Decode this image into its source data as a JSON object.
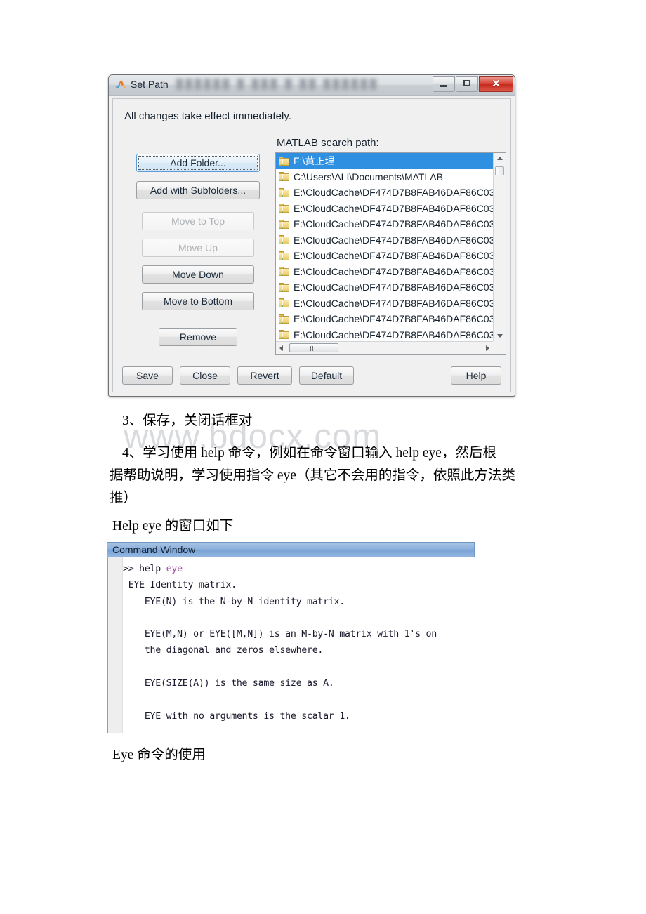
{
  "watermark": {
    "text": "www.bdocx.com"
  },
  "set_path_dialog": {
    "title": "Set Path",
    "logo_icon": "matlab-membrane-icon",
    "ghost_text": "██████ █  ███ █   ██  ██████",
    "window_controls": {
      "minimize": "minimize-icon",
      "maximize": "maximize-icon",
      "close": "✕"
    },
    "notice": "All changes take effect immediately.",
    "list_label": "MATLAB search path:",
    "side_buttons": [
      {
        "id": "add-folder",
        "label": "Add Folder...",
        "enabled": true,
        "focused": true
      },
      {
        "id": "add-subfolders",
        "label": "Add with Subfolders...",
        "enabled": true,
        "focused": false
      },
      {
        "id": "move-to-top",
        "label": "Move to Top",
        "enabled": false,
        "focused": false
      },
      {
        "id": "move-up",
        "label": "Move Up",
        "enabled": false,
        "focused": false
      },
      {
        "id": "move-down",
        "label": "Move Down",
        "enabled": true,
        "focused": false
      },
      {
        "id": "move-to-bottom",
        "label": "Move to Bottom",
        "enabled": true,
        "focused": false
      },
      {
        "id": "remove",
        "label": "Remove",
        "enabled": true,
        "focused": false
      }
    ],
    "footer_buttons": [
      {
        "id": "save",
        "label": "Save"
      },
      {
        "id": "close",
        "label": "Close"
      },
      {
        "id": "revert",
        "label": "Revert"
      },
      {
        "id": "default",
        "label": "Default"
      },
      {
        "id": "help",
        "label": "Help"
      }
    ],
    "path_list": [
      {
        "path": "F:\\黄正理",
        "selected": true
      },
      {
        "path": "C:\\Users\\ALI\\Documents\\MATLAB",
        "selected": false
      },
      {
        "path": "E:\\CloudCache\\DF474D7B8FAB46DAF86C03",
        "selected": false
      },
      {
        "path": "E:\\CloudCache\\DF474D7B8FAB46DAF86C03",
        "selected": false
      },
      {
        "path": "E:\\CloudCache\\DF474D7B8FAB46DAF86C03",
        "selected": false
      },
      {
        "path": "E:\\CloudCache\\DF474D7B8FAB46DAF86C03",
        "selected": false
      },
      {
        "path": "E:\\CloudCache\\DF474D7B8FAB46DAF86C03",
        "selected": false
      },
      {
        "path": "E:\\CloudCache\\DF474D7B8FAB46DAF86C03",
        "selected": false
      },
      {
        "path": "E:\\CloudCache\\DF474D7B8FAB46DAF86C03",
        "selected": false
      },
      {
        "path": "E:\\CloudCache\\DF474D7B8FAB46DAF86C03",
        "selected": false
      },
      {
        "path": "E:\\CloudCache\\DF474D7B8FAB46DAF86C03",
        "selected": false
      },
      {
        "path": "E:\\CloudCache\\DF474D7B8FAB46DAF86C03",
        "selected": false
      }
    ],
    "selection_color": "#2f8fe0"
  },
  "document": {
    "para_3": "3、保存，关闭话框对",
    "para_4_line1": "4、学习使用 help 命令，例如在命令窗口输入 help eye，然后根",
    "para_4_line2": "据帮助说明，学习使用指令 eye（其它不会用的指令，依照此方法类",
    "para_4_line3": "推）",
    "caption_help": "Help eye 的窗口如下",
    "caption_eye": "Eye 命令的使用"
  },
  "command_window": {
    "title": "Command Window",
    "prompt": ">> help ",
    "prompt_arg": "eye",
    "arg_color": "#a64ca6",
    "output_lines": [
      " EYE Identity matrix.",
      "    EYE(N) is the N-by-N identity matrix.",
      "",
      "    EYE(M,N) or EYE([M,N]) is an M-by-N matrix with 1's on",
      "    the diagonal and zeros elsewhere.",
      "",
      "    EYE(SIZE(A)) is the same size as A.",
      "",
      "    EYE with no arguments is the scalar 1."
    ]
  }
}
